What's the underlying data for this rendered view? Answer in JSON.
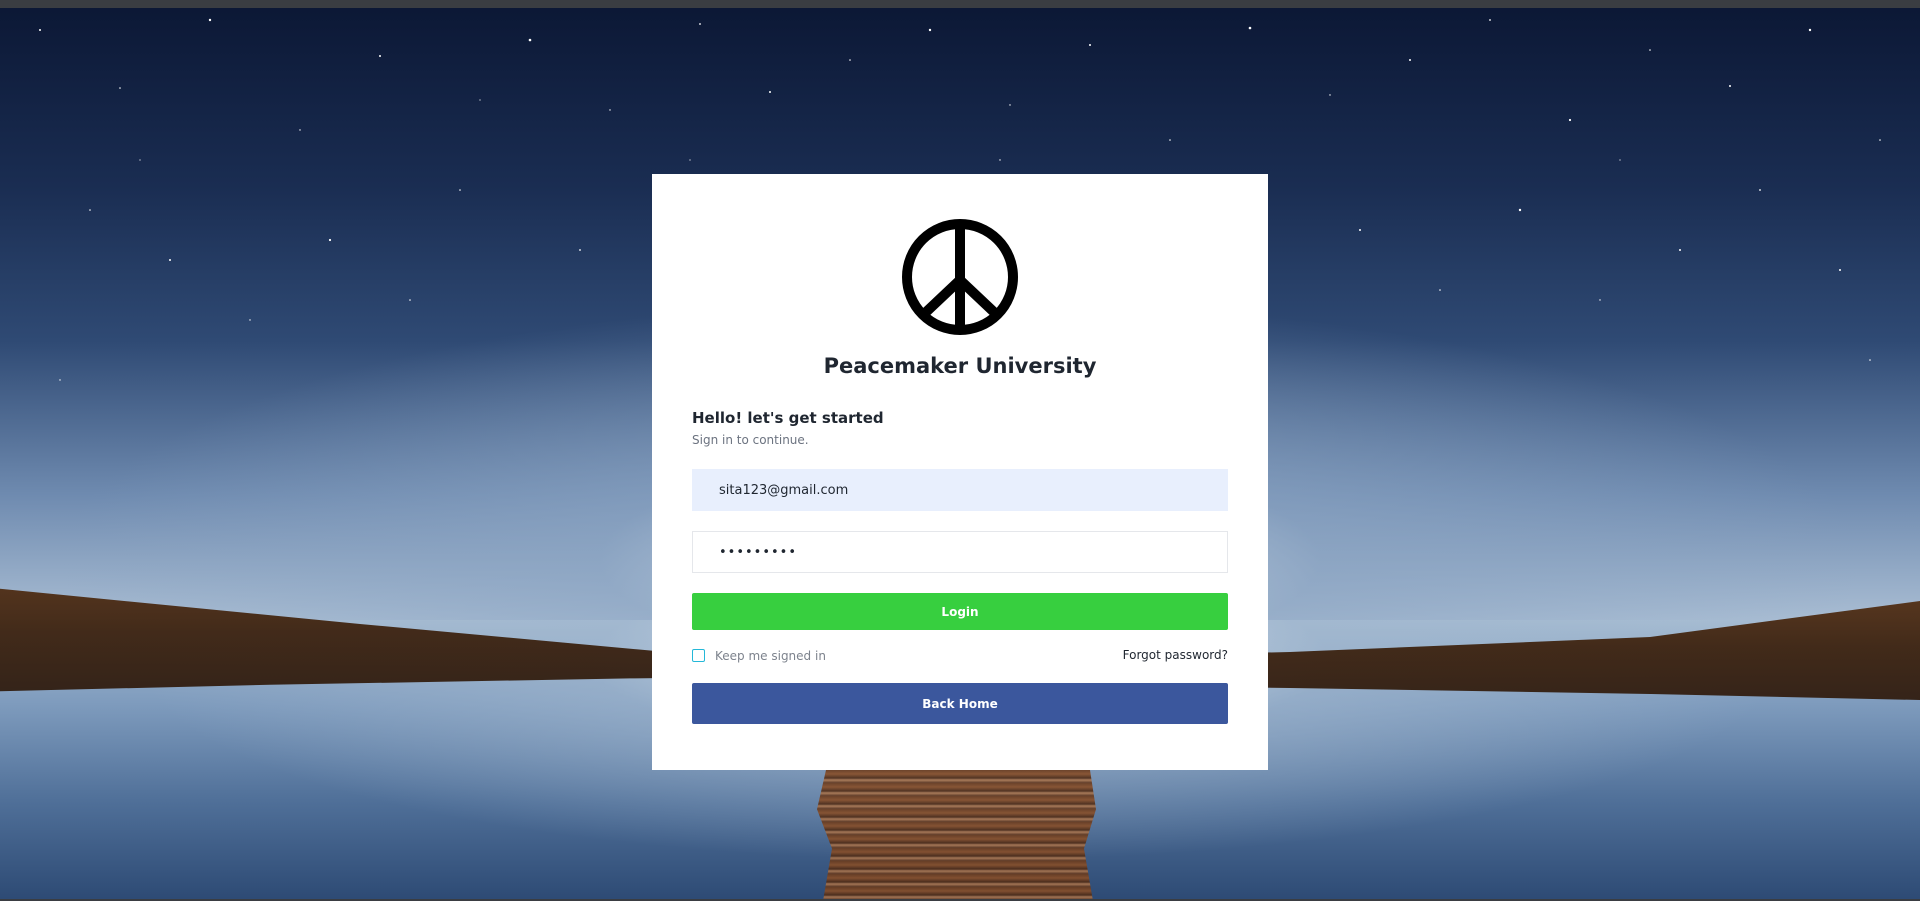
{
  "background": {
    "description_icon": "night-sky-lake-icon"
  },
  "card": {
    "logo_icon": "peace-sign-icon",
    "university_name": "Peacemaker University",
    "greeting": "Hello! let's get started",
    "subtext": "Sign in to continue.",
    "email": {
      "value": "sita123@gmail.com"
    },
    "password": {
      "value": "•••••••••"
    },
    "login_label": "Login",
    "keep_signed_in_label": "Keep me signed in",
    "keep_signed_in_checked": false,
    "forgot_password_label": "Forgot password?",
    "back_home_label": "Back Home"
  },
  "colors": {
    "login_button": "#37cf3f",
    "back_home_button": "#3b579d",
    "email_field_bg": "#e8effd",
    "checkbox_border": "#24b8d8"
  }
}
